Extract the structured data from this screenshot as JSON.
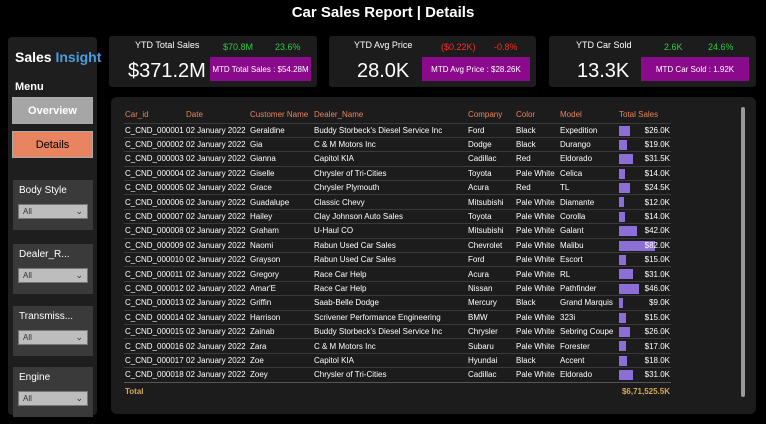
{
  "header": {
    "title": "Car Sales Report | Details"
  },
  "sidebar": {
    "brand_part1": "Sales",
    "brand_part2": "Insight",
    "menu_label": "Menu",
    "nav": [
      {
        "label": "Overview",
        "active": false
      },
      {
        "label": "Details",
        "active": true
      }
    ],
    "slicers": [
      {
        "label": "Body Style",
        "value": "All"
      },
      {
        "label": "Dealer_R...",
        "value": "All"
      },
      {
        "label": "Transmiss...",
        "value": "All"
      },
      {
        "label": "Engine",
        "value": "All"
      }
    ]
  },
  "kpis": [
    {
      "title": "YTD Total Sales",
      "value": "$371.2M",
      "delta1": "$70.8M",
      "delta1_color": "pos",
      "delta2": "23.6%",
      "delta2_color": "pos",
      "mtd": "MTD Total Sales : $54.28M"
    },
    {
      "title": "YTD Avg Price",
      "value": "28.0K",
      "delta1": "($0.22K)",
      "delta1_color": "neg",
      "delta2": "-0.8%",
      "delta2_color": "neg",
      "mtd": "MTD Avg Price : $28.26K"
    },
    {
      "title": "YTD Car Sold",
      "value": "13.3K",
      "delta1": "2.6K",
      "delta1_color": "pos",
      "delta2": "24.6%",
      "delta2_color": "pos",
      "mtd": "MTD Car Sold : 1.92K"
    }
  ],
  "colors": {
    "accent": "#e8845f",
    "mtd_bg": "#8b0a8b",
    "bar": "#8c6fd6",
    "positive": "#2ecc40",
    "negative": "#ff2a2a",
    "total": "#d4a85a"
  },
  "table": {
    "columns": [
      "Car_id",
      "Date",
      "Customer Name",
      "Dealer_Name",
      "Company",
      "Color",
      "Model",
      "Total Sales"
    ],
    "max_sales_k": 82.0,
    "rows": [
      {
        "car_id": "C_CND_000001",
        "date": "02 January 2022",
        "customer": "Geraldine",
        "dealer": "Buddy Storbeck's Diesel Service Inc",
        "company": "Ford",
        "color": "Black",
        "model": "Expedition",
        "sales_text": "$26.0K",
        "sales_k": 26.0
      },
      {
        "car_id": "C_CND_000002",
        "date": "02 January 2022",
        "customer": "Gia",
        "dealer": "C & M Motors Inc",
        "company": "Dodge",
        "color": "Black",
        "model": "Durango",
        "sales_text": "$19.0K",
        "sales_k": 19.0
      },
      {
        "car_id": "C_CND_000003",
        "date": "02 January 2022",
        "customer": "Gianna",
        "dealer": "Capitol KIA",
        "company": "Cadillac",
        "color": "Red",
        "model": "Eldorado",
        "sales_text": "$31.5K",
        "sales_k": 31.5
      },
      {
        "car_id": "C_CND_000004",
        "date": "02 January 2022",
        "customer": "Giselle",
        "dealer": "Chrysler of Tri-Cities",
        "company": "Toyota",
        "color": "Pale White",
        "model": "Celica",
        "sales_text": "$14.0K",
        "sales_k": 14.0
      },
      {
        "car_id": "C_CND_000005",
        "date": "02 January 2022",
        "customer": "Grace",
        "dealer": "Chrysler Plymouth",
        "company": "Acura",
        "color": "Red",
        "model": "TL",
        "sales_text": "$24.5K",
        "sales_k": 24.5
      },
      {
        "car_id": "C_CND_000006",
        "date": "02 January 2022",
        "customer": "Guadalupe",
        "dealer": "Classic Chevy",
        "company": "Mitsubishi",
        "color": "Pale White",
        "model": "Diamante",
        "sales_text": "$12.0K",
        "sales_k": 12.0
      },
      {
        "car_id": "C_CND_000007",
        "date": "02 January 2022",
        "customer": "Hailey",
        "dealer": "Clay Johnson Auto Sales",
        "company": "Toyota",
        "color": "Pale White",
        "model": "Corolla",
        "sales_text": "$14.0K",
        "sales_k": 14.0
      },
      {
        "car_id": "C_CND_000008",
        "date": "02 January 2022",
        "customer": "Graham",
        "dealer": "U-Haul CO",
        "company": "Mitsubishi",
        "color": "Pale White",
        "model": "Galant",
        "sales_text": "$42.0K",
        "sales_k": 42.0
      },
      {
        "car_id": "C_CND_000009",
        "date": "02 January 2022",
        "customer": "Naomi",
        "dealer": "Rabun Used Car Sales",
        "company": "Chevrolet",
        "color": "Pale White",
        "model": "Malibu",
        "sales_text": "$82.0K",
        "sales_k": 82.0
      },
      {
        "car_id": "C_CND_000010",
        "date": "02 January 2022",
        "customer": "Grayson",
        "dealer": "Rabun Used Car Sales",
        "company": "Ford",
        "color": "Pale White",
        "model": "Escort",
        "sales_text": "$15.0K",
        "sales_k": 15.0
      },
      {
        "car_id": "C_CND_000011",
        "date": "02 January 2022",
        "customer": "Gregory",
        "dealer": "Race Car Help",
        "company": "Acura",
        "color": "Pale White",
        "model": "RL",
        "sales_text": "$31.0K",
        "sales_k": 31.0
      },
      {
        "car_id": "C_CND_000012",
        "date": "02 January 2022",
        "customer": "Amar'E",
        "dealer": "Race Car Help",
        "company": "Nissan",
        "color": "Pale White",
        "model": "Pathfinder",
        "sales_text": "$46.0K",
        "sales_k": 46.0
      },
      {
        "car_id": "C_CND_000013",
        "date": "02 January 2022",
        "customer": "Griffin",
        "dealer": "Saab-Belle Dodge",
        "company": "Mercury",
        "color": "Black",
        "model": "Grand Marquis",
        "sales_text": "$9.0K",
        "sales_k": 9.0
      },
      {
        "car_id": "C_CND_000014",
        "date": "02 January 2022",
        "customer": "Harrison",
        "dealer": "Scrivener Performance Engineering",
        "company": "BMW",
        "color": "Pale White",
        "model": "323i",
        "sales_text": "$15.0K",
        "sales_k": 15.0
      },
      {
        "car_id": "C_CND_000015",
        "date": "02 January 2022",
        "customer": "Zainab",
        "dealer": "Buddy Storbeck's Diesel Service Inc",
        "company": "Chrysler",
        "color": "Pale White",
        "model": "Sebring Coupe",
        "sales_text": "$26.0K",
        "sales_k": 26.0
      },
      {
        "car_id": "C_CND_000016",
        "date": "02 January 2022",
        "customer": "Zara",
        "dealer": "C & M Motors Inc",
        "company": "Subaru",
        "color": "Pale White",
        "model": "Forester",
        "sales_text": "$17.0K",
        "sales_k": 17.0
      },
      {
        "car_id": "C_CND_000017",
        "date": "02 January 2022",
        "customer": "Zoe",
        "dealer": "Capitol KIA",
        "company": "Hyundai",
        "color": "Black",
        "model": "Accent",
        "sales_text": "$18.0K",
        "sales_k": 18.0
      },
      {
        "car_id": "C_CND_000018",
        "date": "02 January 2022",
        "customer": "Zoey",
        "dealer": "Chrysler of Tri-Cities",
        "company": "Cadillac",
        "color": "Pale White",
        "model": "Eldorado",
        "sales_text": "$31.0K",
        "sales_k": 31.0
      }
    ],
    "total_label": "Total",
    "total_value": "$6,71,525.5K"
  }
}
